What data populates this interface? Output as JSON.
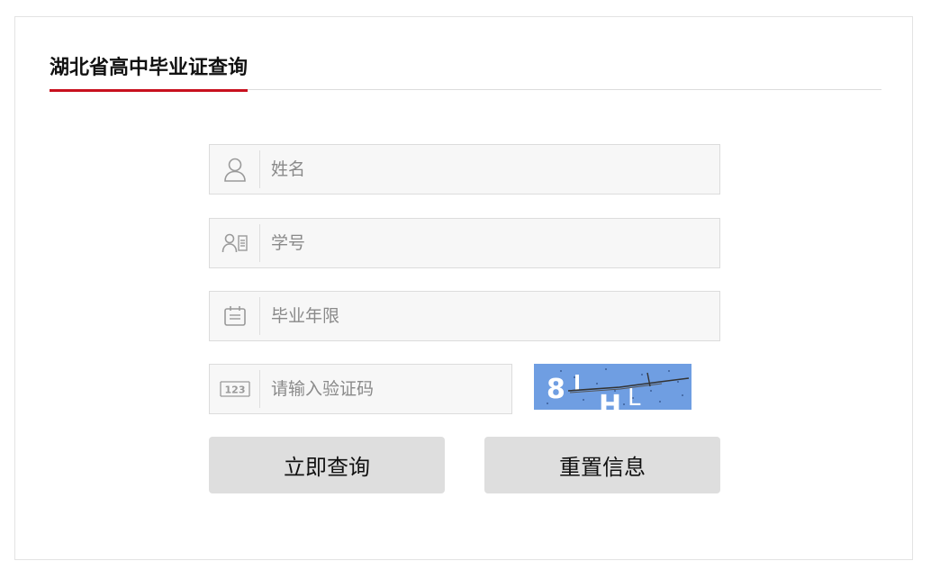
{
  "page": {
    "title": "湖北省高中毕业证查询"
  },
  "form": {
    "name": {
      "placeholder": "姓名",
      "value": "",
      "icon": "user-icon"
    },
    "student_id": {
      "placeholder": "学号",
      "value": "",
      "icon": "id-card-icon"
    },
    "grad_year": {
      "placeholder": "毕业年限",
      "value": "",
      "icon": "calendar-icon"
    },
    "captcha": {
      "placeholder": "请输入验证码",
      "value": "",
      "icon": "number-code-icon",
      "image_text": "8 I H L"
    }
  },
  "buttons": {
    "submit_label": "立即查询",
    "reset_label": "重置信息"
  },
  "colors": {
    "accent": "#c8101e",
    "field_bg": "#f7f7f7",
    "button_bg": "#dedede",
    "captcha_bg": "#6f9ee2"
  }
}
